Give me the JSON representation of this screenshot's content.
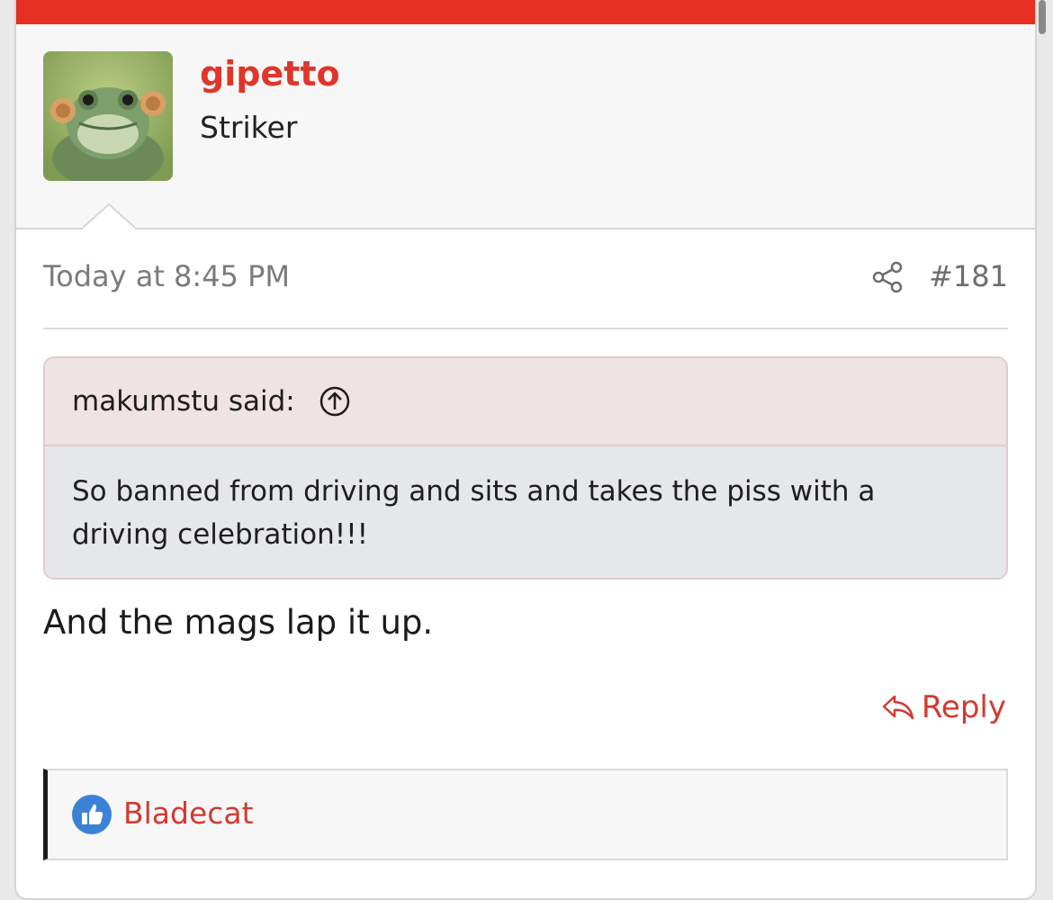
{
  "colors": {
    "accent": "#e52f22",
    "username": "#e0352a",
    "link": "#d33a2f",
    "quote_header_bg": "#efe3e4",
    "quote_body_bg": "#e6e7ea"
  },
  "post": {
    "username": "gipetto",
    "user_title": "Striker",
    "avatar_icon": "frog-avatar",
    "timestamp": "Today at 8:45 PM",
    "share_icon": "share-icon",
    "post_number": "#181",
    "quote": {
      "author": "makumstu said:",
      "jump_icon": "arrow-up-circle-icon",
      "text": "So banned from driving and sits and takes the piss with a driving celebration!!!"
    },
    "body": "And the mags lap it up.",
    "reply_label": "Reply",
    "reply_icon": "reply-icon",
    "reactions": {
      "icon": "thumbs-up-icon",
      "users": "Bladecat"
    }
  }
}
